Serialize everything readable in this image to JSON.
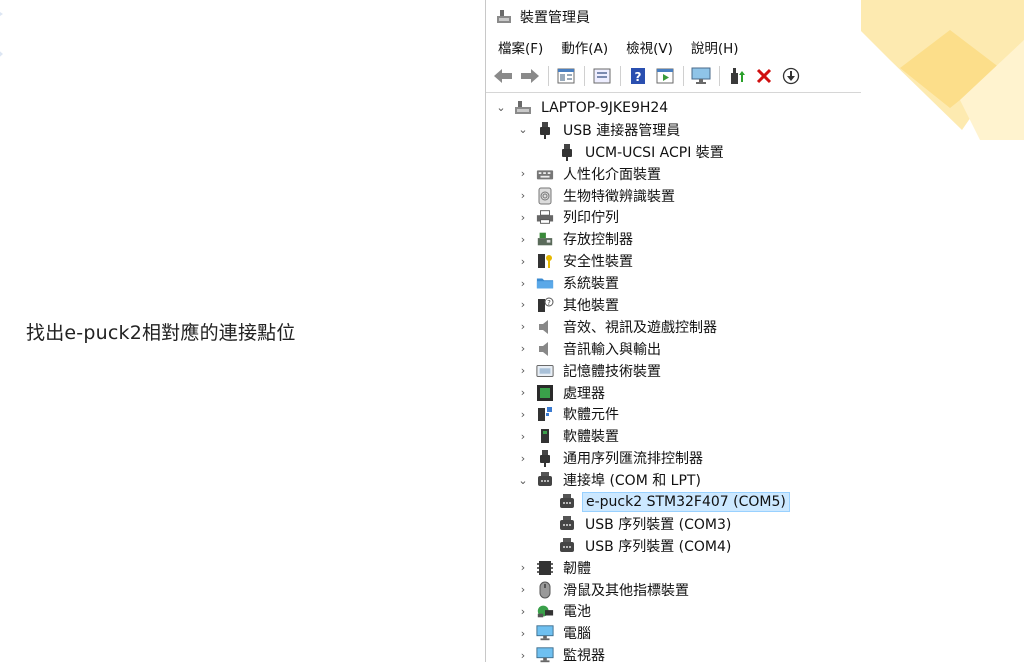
{
  "slide": {
    "instruction": "找出e-puck2相對應的連接點位"
  },
  "window": {
    "title": "裝置管理員",
    "menu": [
      "檔案(F)",
      "動作(A)",
      "檢視(V)",
      "說明(H)"
    ],
    "toolbar_icons": [
      "back-arrow-icon",
      "forward-arrow-icon",
      "properties-icon",
      "update-icon",
      "help-icon",
      "view-icon",
      "monitor-icon",
      "add-driver-icon",
      "remove-icon",
      "download-icon"
    ]
  },
  "tree": {
    "root": "LAPTOP-9JKE9H24",
    "usb_connector_manager": "USB 連接器管理員",
    "ucm_ucsi": "UCM-UCSI ACPI 裝置",
    "hid": "人性化介面裝置",
    "biometric": "生物特徵辨識裝置",
    "print_queue": "列印佇列",
    "storage_controller": "存放控制器",
    "security_devices": "安全性裝置",
    "system_devices": "系統裝置",
    "other_devices": "其他裝置",
    "sound": "音效、視訊及遊戲控制器",
    "audio_io": "音訊輸入與輸出",
    "memory_tech": "記憶體技術裝置",
    "processors": "處理器",
    "software_components": "軟體元件",
    "software_devices": "軟體裝置",
    "usb_controllers": "通用序列匯流排控制器",
    "ports": "連接埠 (COM 和 LPT)",
    "epuck": "e-puck2 STM32F407 (COM5)",
    "usb_serial_3": "USB 序列裝置 (COM3)",
    "usb_serial_4": "USB 序列裝置 (COM4)",
    "firmware": "韌體",
    "mice": "滑鼠及其他指標裝置",
    "battery": "電池",
    "computer": "電腦",
    "monitors": "監視器"
  },
  "colors": {
    "selection_bg": "#cce8ff",
    "accent_yellow": "#fde9a8"
  }
}
